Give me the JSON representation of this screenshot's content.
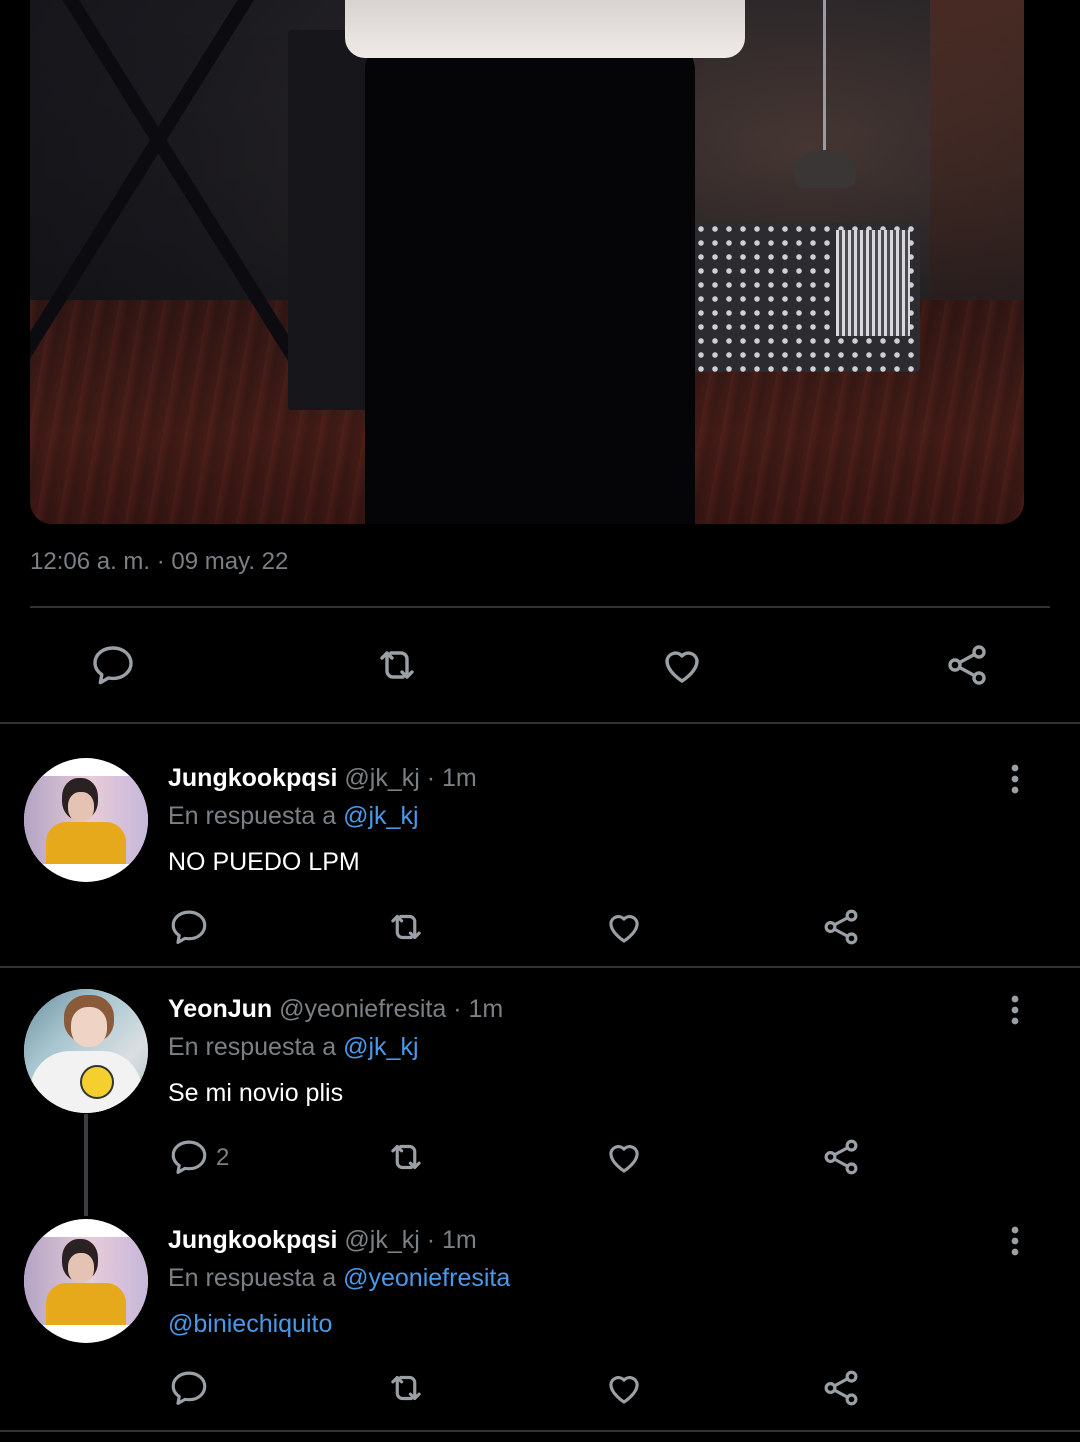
{
  "tweet": {
    "timestamp": "12:06 a. m. · 09 may. 22"
  },
  "icons": {
    "reply": "reply-icon",
    "retweet": "retweet-icon",
    "like": "heart-icon",
    "share": "share-icon",
    "more": "more-vertical-icon"
  },
  "colors": {
    "background": "#000000",
    "muted": "#7b8085",
    "link": "#4a99e9",
    "divider": "#2f3336"
  },
  "replies": [
    {
      "name": "Jungkookpqsi",
      "handle": "@jk_kj · 1m",
      "reply_prefix": "En respuesta a ",
      "reply_to": "@jk_kj",
      "text": "NO PUEDO LPM",
      "reply_count": ""
    },
    {
      "name": "YeonJun",
      "handle": "@yeoniefresita · 1m",
      "reply_prefix": "En respuesta a ",
      "reply_to": "@jk_kj",
      "text": "Se mi novio plis",
      "reply_count": "2"
    },
    {
      "name": "Jungkookpqsi",
      "handle": "@jk_kj · 1m",
      "reply_prefix": "En respuesta a ",
      "reply_to": "@yeoniefresita",
      "text": "@biniechiquito",
      "reply_count": ""
    }
  ]
}
